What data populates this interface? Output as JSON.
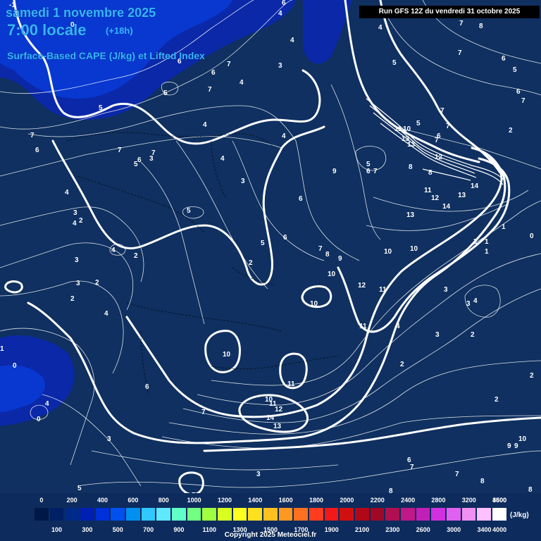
{
  "header": {
    "date": "samedi 1 novembre 2025",
    "time": "7:00 locale",
    "step": "(+18h)",
    "parameter": "Surface-Based CAPE (J/kg) et Lifted Index",
    "run": "Run GFS 12Z du vendredi 31 octobre 2025"
  },
  "legend": {
    "unit": "(J/kg)",
    "top_labels": [
      "0",
      "200",
      "400",
      "600",
      "800",
      "1000",
      "1200",
      "1400",
      "1600",
      "1800",
      "2000",
      "2200",
      "2400",
      "2800",
      "3200",
      "3600",
      "4500"
    ],
    "bottom_labels": [
      "100",
      "300",
      "500",
      "700",
      "900",
      "1100",
      "1300",
      "1500",
      "1700",
      "1900",
      "2100",
      "2300",
      "2600",
      "3000",
      "3400",
      "4000"
    ],
    "colors": [
      "#001848",
      "#002066",
      "#002a8a",
      "#0020b4",
      "#0030d8",
      "#0050f0",
      "#0090f0",
      "#30c8ff",
      "#60e8ff",
      "#60ffc8",
      "#70ff80",
      "#a0ff40",
      "#d8ff20",
      "#ffff20",
      "#ffe020",
      "#ffc020",
      "#ff9820",
      "#ff7020",
      "#ff3c20",
      "#f01818",
      "#d01010",
      "#b00818",
      "#a00828",
      "#b01050",
      "#c01888",
      "#c020b8",
      "#d030e0",
      "#e060f0",
      "#f090f0",
      "#ffc0ff",
      "#ffffff"
    ]
  },
  "footer": {
    "copyright": "Copyright 2025 Meteociel.fr"
  },
  "map": {
    "background": "#0f3060",
    "cape_low_color": "#0a28a8",
    "cape_mid_color": "#0838d0",
    "contour_labels": [
      "-1",
      "6",
      "4",
      "0",
      "6",
      "7",
      "5",
      "6",
      "7",
      "4",
      "4",
      "3",
      "5",
      "7",
      "7",
      "7",
      "6",
      "5",
      "6",
      "5",
      "4",
      "7",
      "4",
      "2",
      "6",
      "8",
      "7",
      "5",
      "7",
      "7",
      "4",
      "6",
      "7",
      "6",
      "5",
      "7",
      "3",
      "4",
      "4",
      "3",
      "11",
      "10",
      "13",
      "13",
      "12",
      "5",
      "6",
      "7",
      "8",
      "9",
      "8",
      "4",
      "2",
      "3",
      "5",
      "6",
      "11",
      "12",
      "14",
      "14",
      "13",
      "13",
      "1",
      "1",
      "0",
      "4",
      "5",
      "2",
      "3",
      "6",
      "7",
      "2",
      "8",
      "9",
      "10",
      "10",
      "2",
      "1",
      "3",
      "2",
      "4",
      "12",
      "11",
      "10",
      "4",
      "3",
      "10",
      "11",
      "3",
      "4",
      "2",
      "2",
      "2",
      "10",
      "11",
      "0",
      "1",
      "6",
      "3",
      "7",
      "10",
      "11",
      "12",
      "14",
      "13",
      "2",
      "4",
      "0",
      "2",
      "3",
      "3",
      "9",
      "9",
      "10",
      "6",
      "7",
      "7",
      "8",
      "8",
      "5",
      "7",
      "8"
    ]
  }
}
